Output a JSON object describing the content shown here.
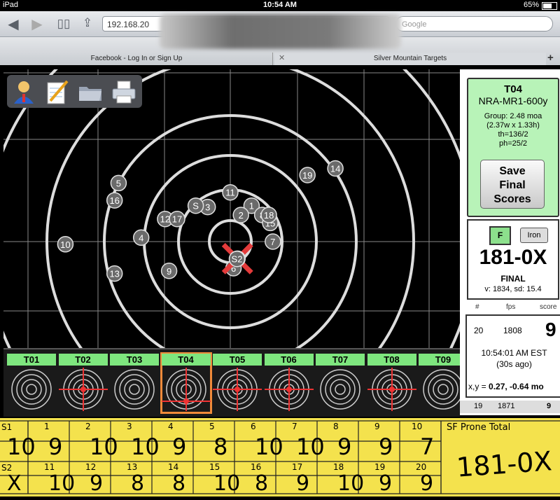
{
  "status": {
    "device": "iPad",
    "time": "10:54 AM",
    "battery": "65%"
  },
  "browser": {
    "url": "192.168.20",
    "search_placeholder": "Google",
    "tabs": [
      {
        "label": "Facebook - Log In or Sign Up"
      },
      {
        "label": "Silver Mountain Targets"
      }
    ]
  },
  "target": {
    "shots": [
      {
        "label": "1",
        "x": 0.8,
        "y": 1.35
      },
      {
        "label": "2",
        "x": 0.4,
        "y": 1.0
      },
      {
        "label": "3",
        "x": -0.85,
        "y": 1.3
      },
      {
        "label": "4",
        "x": -3.35,
        "y": 0.15
      },
      {
        "label": "5",
        "x": -4.2,
        "y": 2.2
      },
      {
        "label": "6",
        "x": 0.12,
        "y": -1.0
      },
      {
        "label": "7",
        "x": 1.6,
        "y": 0.0
      },
      {
        "label": "8",
        "x": 1.2,
        "y": 1.0
      },
      {
        "label": "9",
        "x": -2.3,
        "y": -1.1
      },
      {
        "label": "10",
        "x": -6.2,
        "y": -0.1
      },
      {
        "label": "11",
        "x": 0.0,
        "y": 1.85
      },
      {
        "label": "12",
        "x": -2.45,
        "y": 0.85
      },
      {
        "label": "13",
        "x": -4.35,
        "y": -1.2
      },
      {
        "label": "14",
        "x": 3.95,
        "y": 2.75
      },
      {
        "label": "15",
        "x": 1.5,
        "y": 0.7
      },
      {
        "label": "16",
        "x": -4.35,
        "y": 1.55
      },
      {
        "label": "17",
        "x": -2.0,
        "y": 0.85
      },
      {
        "label": "18",
        "x": 1.45,
        "y": 1.0
      },
      {
        "label": "19",
        "x": 2.9,
        "y": 2.5
      },
      {
        "label": "20",
        "x": 0.27,
        "y": -0.64
      },
      {
        "label": "S",
        "x": -1.3,
        "y": 1.35
      },
      {
        "label": "S2",
        "x": 0.25,
        "y": -0.65
      }
    ],
    "last_shot": "20"
  },
  "thumbnails": [
    {
      "label": "T01",
      "hits": false
    },
    {
      "label": "T02",
      "hits": true
    },
    {
      "label": "T03",
      "hits": false
    },
    {
      "label": "T04",
      "hits": true,
      "selected": true
    },
    {
      "label": "T05",
      "hits": true
    },
    {
      "label": "T06",
      "hits": true
    },
    {
      "label": "T07",
      "hits": false
    },
    {
      "label": "T08",
      "hits": true
    },
    {
      "label": "T09",
      "hits": false
    }
  ],
  "panel": {
    "target_id": "T04",
    "course": "NRA-MR1-600y",
    "group": "Group: 2.48 moa",
    "group_dims": "(2.37w x 1.33h)",
    "th": "th=136/2",
    "ph": "ph=25/2",
    "save_label": "Save Final Scores",
    "f_label": "F",
    "iron_label": "Iron",
    "score": "181-0X",
    "final_label": "FINAL",
    "velocity": "v: 1834, sd: 15.4",
    "col_num": "#",
    "col_fps": "fps",
    "col_score": "score",
    "shot_num": "20",
    "shot_fps": "1808",
    "shot_score": "9",
    "shot_time": "10:54:01 AM EST",
    "shot_ago": "(30s ago)",
    "xy_label": "x,y =",
    "xy_value": "0.27, -0.64 mo",
    "prev_num": "19",
    "prev_fps": "1871",
    "prev_score": "9"
  },
  "scorecard": {
    "row1_label": "S1",
    "row2_label": "S2",
    "total_label": "SF Prone Total",
    "numbers_top": [
      "1",
      "2",
      "3",
      "4",
      "5",
      "6",
      "7",
      "8",
      "9",
      "10"
    ],
    "numbers_bottom": [
      "11",
      "12",
      "13",
      "14",
      "15",
      "16",
      "17",
      "18",
      "19",
      "20"
    ],
    "row1_values": [
      "10",
      "9",
      "10",
      "10",
      "9",
      "8",
      "10",
      "10",
      "9",
      "9",
      "7"
    ],
    "row2_values": [
      "X",
      "10",
      "9",
      "8",
      "8",
      "10",
      "8",
      "9",
      "10",
      "9",
      "9"
    ],
    "total_written": "181-0X"
  }
}
